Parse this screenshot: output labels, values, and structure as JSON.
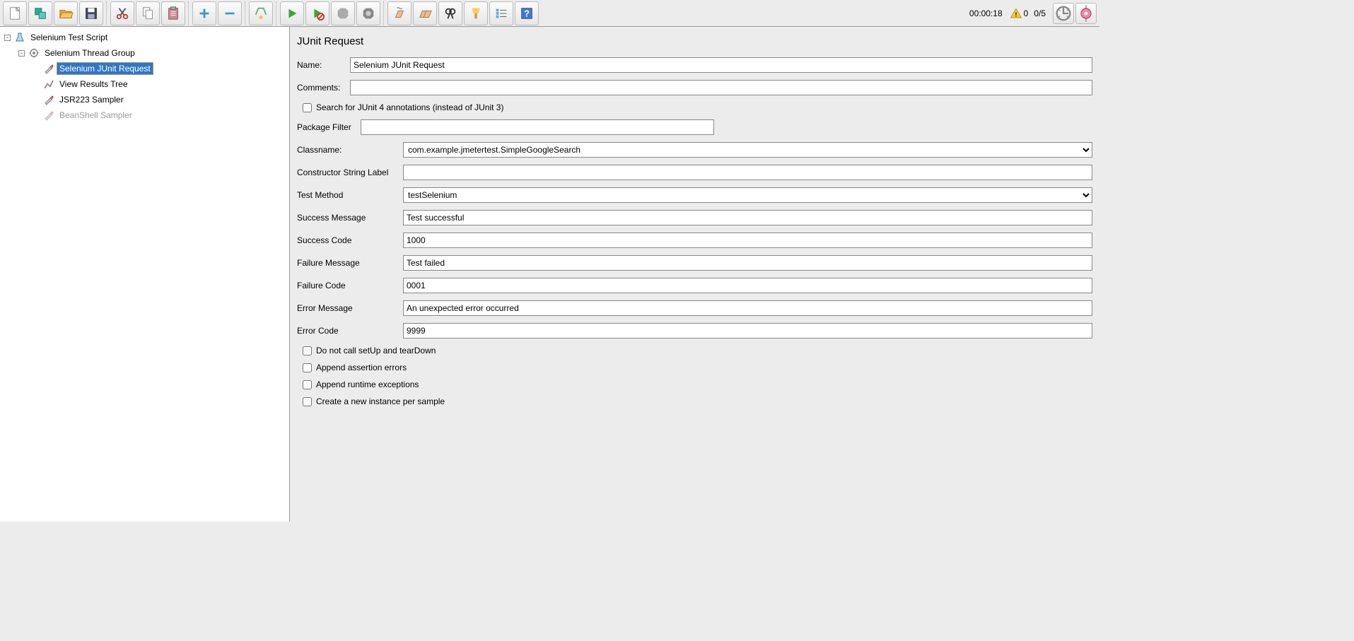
{
  "toolbar": {
    "icons": [
      {
        "name": "new-file-icon"
      },
      {
        "name": "templates-icon"
      },
      {
        "name": "open-icon"
      },
      {
        "name": "save-icon"
      },
      {
        "name": "cut-icon"
      },
      {
        "name": "copy-icon"
      },
      {
        "name": "paste-icon"
      },
      {
        "name": "expand-icon"
      },
      {
        "name": "collapse-icon"
      },
      {
        "name": "toggle-icon"
      },
      {
        "name": "start-icon"
      },
      {
        "name": "start-no-timers-icon"
      },
      {
        "name": "stop-icon"
      },
      {
        "name": "shutdown-icon"
      },
      {
        "name": "clear-icon"
      },
      {
        "name": "clear-all-icon"
      },
      {
        "name": "search-icon"
      },
      {
        "name": "reset-search-icon"
      },
      {
        "name": "function-helper-icon"
      },
      {
        "name": "help-icon"
      }
    ],
    "timer": "00:00:18",
    "warnings_count": "0",
    "thread_count": "0/5",
    "right_icons": [
      {
        "name": "threads-indicator-icon"
      },
      {
        "name": "collapse-expand-icon"
      }
    ]
  },
  "tree": {
    "root": {
      "label": "Selenium Test Script"
    },
    "thread_group": {
      "label": "Selenium Thread Group"
    },
    "junit_request": {
      "label": "Selenium JUnit Request"
    },
    "view_results": {
      "label": "View Results Tree"
    },
    "jsr223": {
      "label": "JSR223 Sampler"
    },
    "beanshell": {
      "label": "BeanShell Sampler"
    }
  },
  "panel": {
    "title": "JUnit Request",
    "name_label": "Name:",
    "name_value": "Selenium JUnit Request",
    "comments_label": "Comments:",
    "comments_value": "",
    "junit4_label": "Search for JUnit 4 annotations (instead of JUnit 3)",
    "package_filter_label": "Package Filter",
    "package_filter_value": "",
    "classname_label": "Classname:",
    "classname_value": "com.example.jmetertest.SimpleGoogleSearch",
    "constructor_label": "Constructor String Label",
    "constructor_value": "",
    "test_method_label": "Test Method",
    "test_method_value": "testSelenium",
    "success_msg_label": "Success Message",
    "success_msg_value": "Test successful",
    "success_code_label": "Success Code",
    "success_code_value": "1000",
    "failure_msg_label": "Failure Message",
    "failure_msg_value": "Test failed",
    "failure_code_label": "Failure Code",
    "failure_code_value": "0001",
    "error_msg_label": "Error Message",
    "error_msg_value": "An unexpected error occurred",
    "error_code_label": "Error Code",
    "error_code_value": "9999",
    "no_setup_teardown_label": "Do not call setUp and tearDown",
    "append_assertion_label": "Append assertion errors",
    "append_runtime_label": "Append runtime exceptions",
    "new_instance_label": "Create a new instance per sample"
  }
}
